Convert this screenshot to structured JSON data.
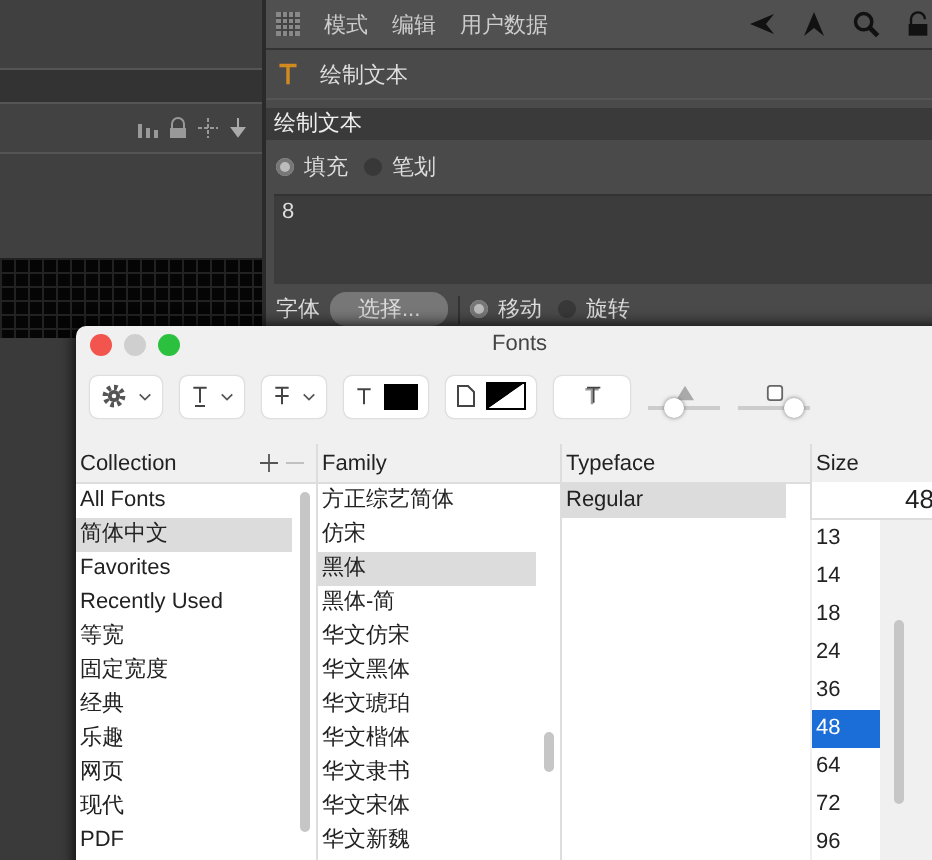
{
  "attribute_panel": {
    "menu": [
      "模式",
      "编辑",
      "用户数据"
    ],
    "object_title": "绘制文本",
    "section_title": "绘制文本",
    "fill_mode": [
      {
        "label": "填充",
        "selected": true
      },
      {
        "label": "笔划",
        "selected": false
      }
    ],
    "text_value": "8",
    "font_label": "字体",
    "font_button": "选择...",
    "transform_mode": [
      {
        "label": "移动",
        "selected": true
      },
      {
        "label": "旋转",
        "selected": false
      }
    ]
  },
  "fonts_window": {
    "title": "Fonts",
    "shadow_sliders": [
      {
        "level": 0.3
      },
      {
        "level": 0.9
      }
    ],
    "columns": [
      "Collection",
      "Family",
      "Typeface",
      "Size"
    ],
    "collections": [
      {
        "label": "All Fonts",
        "selected": false
      },
      {
        "label": "简体中文",
        "selected": true
      },
      {
        "label": "Favorites",
        "selected": false
      },
      {
        "label": "Recently Used",
        "selected": false
      },
      {
        "label": "等宽",
        "selected": false
      },
      {
        "label": "固定宽度",
        "selected": false
      },
      {
        "label": "经典",
        "selected": false
      },
      {
        "label": "乐趣",
        "selected": false
      },
      {
        "label": "网页",
        "selected": false
      },
      {
        "label": "现代",
        "selected": false
      },
      {
        "label": "PDF",
        "selected": false
      }
    ],
    "families": [
      {
        "label": "方正综艺简体",
        "selected": false
      },
      {
        "label": "仿宋",
        "selected": false
      },
      {
        "label": "黑体",
        "selected": true
      },
      {
        "label": "黑体-简",
        "selected": false
      },
      {
        "label": "华文仿宋",
        "selected": false
      },
      {
        "label": "华文黑体",
        "selected": false
      },
      {
        "label": "华文琥珀",
        "selected": false
      },
      {
        "label": "华文楷体",
        "selected": false
      },
      {
        "label": "华文隶书",
        "selected": false
      },
      {
        "label": "华文宋体",
        "selected": false
      },
      {
        "label": "华文新魏",
        "selected": false
      }
    ],
    "typefaces": [
      {
        "label": "Regular",
        "selected": true
      }
    ],
    "size_value": "48",
    "sizes": [
      {
        "label": "13",
        "selected": false
      },
      {
        "label": "14",
        "selected": false
      },
      {
        "label": "18",
        "selected": false
      },
      {
        "label": "24",
        "selected": false
      },
      {
        "label": "36",
        "selected": false
      },
      {
        "label": "48",
        "selected": true
      },
      {
        "label": "64",
        "selected": false
      },
      {
        "label": "72",
        "selected": false
      },
      {
        "label": "96",
        "selected": false
      }
    ]
  }
}
